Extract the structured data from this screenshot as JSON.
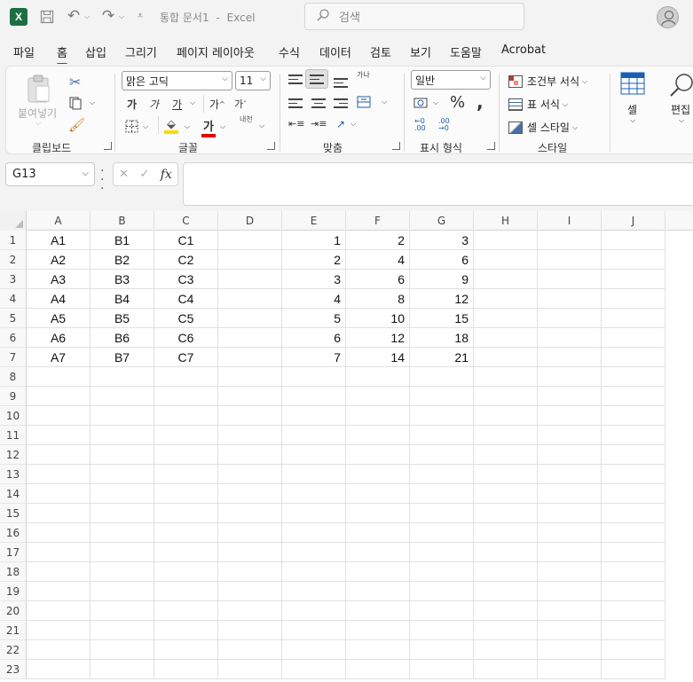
{
  "app": {
    "document_title": "통합 문서1",
    "separator": "-",
    "app_name": "Excel",
    "search_placeholder": "검색",
    "icons": [
      "excel-logo",
      "save-icon",
      "undo-icon",
      "redo-icon",
      "customize-qat-icon",
      "search-icon",
      "account-icon"
    ]
  },
  "menu": {
    "tabs": [
      {
        "label": "파일",
        "active": false
      },
      {
        "label": "홈",
        "active": true
      },
      {
        "label": "삽입",
        "active": false
      },
      {
        "label": "그리기",
        "active": false
      },
      {
        "label": "페이지 레이아웃",
        "active": false
      },
      {
        "label": "수식",
        "active": false
      },
      {
        "label": "데이터",
        "active": false
      },
      {
        "label": "검토",
        "active": false
      },
      {
        "label": "보기",
        "active": false
      },
      {
        "label": "도움말",
        "active": false
      },
      {
        "label": "Acrobat",
        "active": false
      }
    ]
  },
  "ribbon": {
    "clipboard": {
      "label": "클립보드",
      "paste_label": "붙여넣기"
    },
    "font": {
      "label": "글꼴",
      "font_name": "맑은 고딕",
      "font_size": "11",
      "bold_glyph": "가",
      "italic_glyph": "가",
      "underline_glyph": "가",
      "grow_glyph": "가",
      "shrink_glyph": "가",
      "color_glyph": "가",
      "phonetic_glyph": "내천"
    },
    "alignment": {
      "label": "맞춤",
      "wrap_glyph": "가나"
    },
    "number": {
      "label": "표시 형식",
      "format": "일반",
      "percent": "%",
      "comma": ","
    },
    "styles": {
      "label": "스타일",
      "conditional": "조건부 서식",
      "table": "표 서식",
      "cell": "셀 스타일"
    },
    "cells": {
      "label": "셀"
    },
    "editing": {
      "label": "편집"
    }
  },
  "formula_bar": {
    "name_box": "G13",
    "fx": "fx",
    "formula": ""
  },
  "sheet": {
    "columns": [
      "A",
      "B",
      "C",
      "D",
      "E",
      "F",
      "G",
      "H",
      "I",
      "J"
    ],
    "rows": [
      "1",
      "2",
      "3",
      "4",
      "5",
      "6",
      "7",
      "8",
      "9",
      "10",
      "11",
      "12",
      "13",
      "14",
      "15",
      "16",
      "17",
      "18",
      "19",
      "20",
      "21",
      "22",
      "23"
    ],
    "data": [
      [
        "A1",
        "B1",
        "C1",
        "",
        "1",
        "2",
        "3"
      ],
      [
        "A2",
        "B2",
        "C2",
        "",
        "2",
        "4",
        "6"
      ],
      [
        "A3",
        "B3",
        "C3",
        "",
        "3",
        "6",
        "9"
      ],
      [
        "A4",
        "B4",
        "C4",
        "",
        "4",
        "8",
        "12"
      ],
      [
        "A5",
        "B5",
        "C5",
        "",
        "5",
        "10",
        "15"
      ],
      [
        "A6",
        "B6",
        "C6",
        "",
        "6",
        "12",
        "18"
      ],
      [
        "A7",
        "B7",
        "C7",
        "",
        "7",
        "14",
        "21"
      ]
    ]
  },
  "colors": {
    "accent": "#1d6f42",
    "fill_yellow": "#ffd800",
    "font_red": "#e00000"
  }
}
